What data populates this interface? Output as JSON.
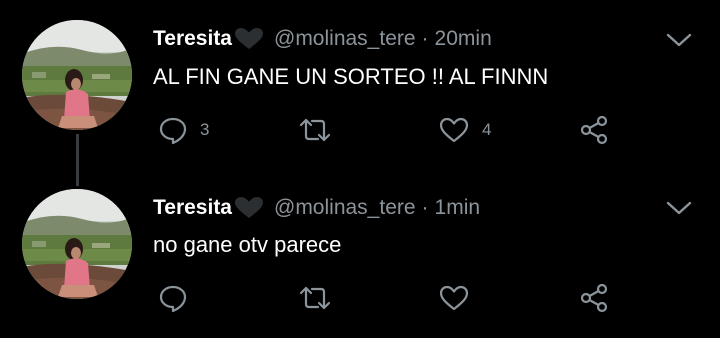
{
  "tweets": [
    {
      "display_name": "Teresita",
      "handle": "@molinas_tere",
      "separator": "·",
      "time": "20min",
      "text": "AL FIN GANE UN SORTEO !! AL FINNN",
      "reply_count": "3",
      "retweet_count": "",
      "like_count": "4"
    },
    {
      "display_name": "Teresita",
      "handle": "@molinas_tere",
      "separator": "·",
      "time": "1min",
      "text": "no gane otv parece",
      "reply_count": "",
      "retweet_count": "",
      "like_count": ""
    }
  ],
  "icons": {
    "name_badge": "black-heart-icon",
    "reply": "reply-icon",
    "retweet": "retweet-icon",
    "like": "heart-outline-icon",
    "share": "share-icon",
    "menu": "chevron-down-icon"
  },
  "colors": {
    "background": "#000000",
    "text": "#ffffff",
    "secondary_text": "#8b949a",
    "thread_line": "#3a3d40"
  }
}
